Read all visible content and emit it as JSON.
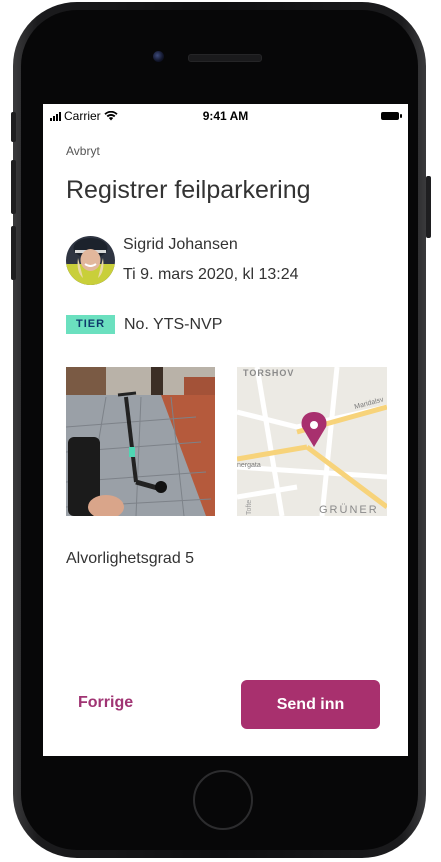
{
  "status_bar": {
    "carrier": "Carrier",
    "time": "9:41 AM"
  },
  "nav": {
    "cancel_label": "Avbryt"
  },
  "page": {
    "title": "Registrer feilparkering"
  },
  "reporter": {
    "name": "Sigrid Johansen",
    "datetime": "Ti 9. mars 2020, kl 13:24"
  },
  "vehicle": {
    "brand_logo_text": "TIER",
    "plate": "No. YTS-NVP"
  },
  "map": {
    "labels": [
      "TORSHOV",
      "Maridalsv",
      "nergata",
      "Tofte",
      "GRÜNER"
    ],
    "pin_color": "#a8306e"
  },
  "severity": {
    "label": "Alvorlighetsgrad 5"
  },
  "actions": {
    "prev_label": "Forrige",
    "submit_label": "Send inn"
  },
  "colors": {
    "accent": "#a8306e",
    "tier_brand": "#6be0bf"
  }
}
